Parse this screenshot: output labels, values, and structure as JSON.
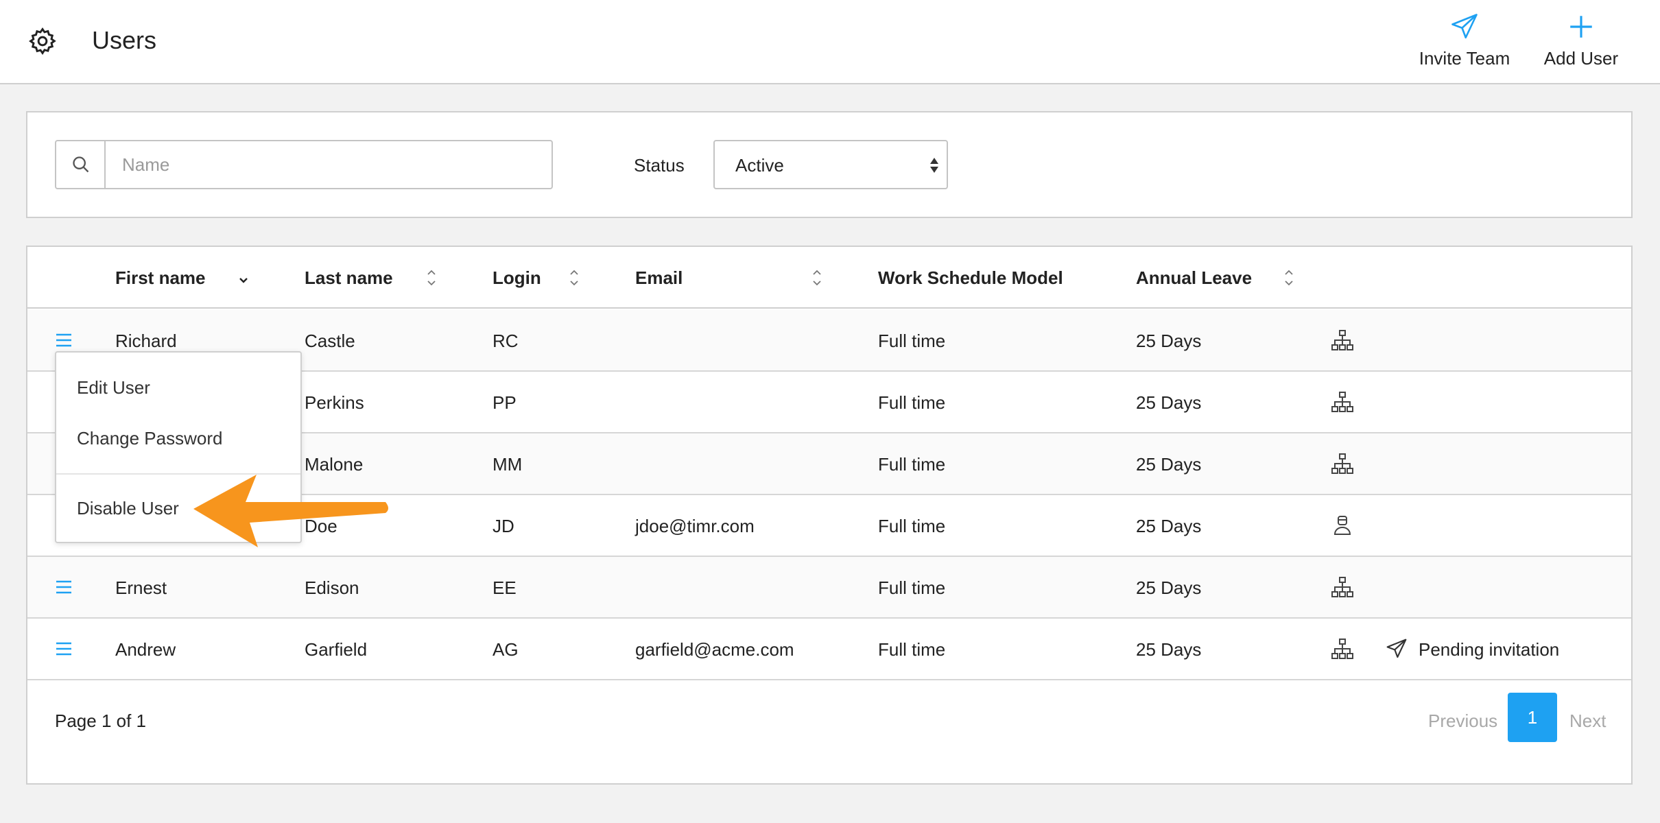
{
  "header": {
    "title": "Users",
    "icon": "gear-icon",
    "actions": [
      {
        "label": "Invite Team",
        "icon": "paper-plane-icon"
      },
      {
        "label": "Add User",
        "icon": "plus-icon"
      }
    ]
  },
  "filters": {
    "search_placeholder": "Name",
    "search_value": "",
    "status_label": "Status",
    "status_value": "Active"
  },
  "table": {
    "columns": [
      "First name",
      "Last name",
      "Login",
      "Email",
      "Work Schedule Model",
      "Annual Leave"
    ],
    "rows": [
      {
        "first": "Richard",
        "last": "Castle",
        "login": "RC",
        "email": "",
        "schedule": "Full time",
        "leave": "25 Days",
        "icon": "org-chart-icon",
        "note": ""
      },
      {
        "first": "",
        "last": "Perkins",
        "login": "PP",
        "email": "",
        "schedule": "Full time",
        "leave": "25 Days",
        "icon": "org-chart-icon",
        "note": ""
      },
      {
        "first": "",
        "last": "Malone",
        "login": "MM",
        "email": "",
        "schedule": "Full time",
        "leave": "25 Days",
        "icon": "org-chart-icon",
        "note": ""
      },
      {
        "first": "",
        "last": "Doe",
        "login": "JD",
        "email": "jdoe@timr.com",
        "schedule": "Full time",
        "leave": "25 Days",
        "icon": "user-badge-icon",
        "note": ""
      },
      {
        "first": "Ernest",
        "last": "Edison",
        "login": "EE",
        "email": "",
        "schedule": "Full time",
        "leave": "25 Days",
        "icon": "org-chart-icon",
        "note": ""
      },
      {
        "first": "Andrew",
        "last": "Garfield",
        "login": "AG",
        "email": "garfield@acme.com",
        "schedule": "Full time",
        "leave": "25 Days",
        "icon": "org-chart-icon",
        "note": "Pending invitation"
      }
    ]
  },
  "pagination": {
    "page_text": "Page 1 of 1",
    "previous": "Previous",
    "current": "1",
    "next": "Next"
  },
  "context_menu": {
    "items": [
      "Edit User",
      "Change Password",
      "Disable User"
    ]
  },
  "colors": {
    "accent": "#1ea1f2",
    "annotation_arrow": "#f7951d"
  }
}
